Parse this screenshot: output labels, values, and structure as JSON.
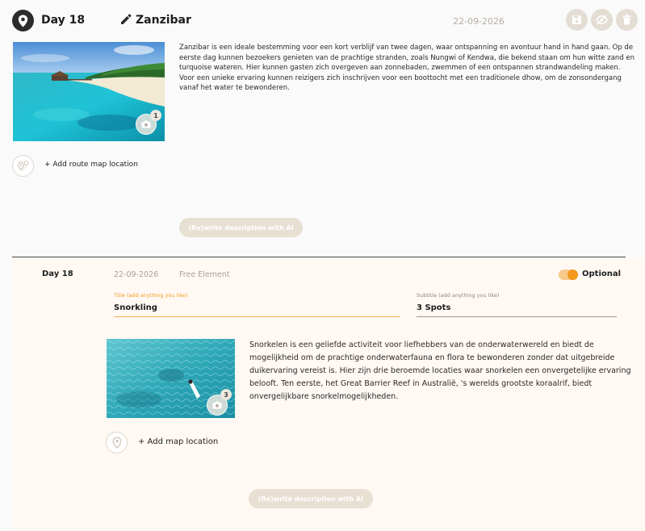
{
  "day_entry": {
    "day_label": "Day 18",
    "destination": "Zanzibar",
    "date": "22-09-2026",
    "actions": [
      {
        "icon": "save-icon"
      },
      {
        "icon": "eye-off-icon"
      },
      {
        "icon": "trash-icon"
      }
    ],
    "photo_count": "1",
    "description": "Zanzibar is een ideale bestemming voor een kort verblijf van twee dagen, waar ontspanning en avontuur hand in hand gaan. Op de eerste dag kunnen bezoekers genieten van de prachtige stranden, zoals Nungwi of Kendwa, die bekend staan om hun witte zand en turquoise wateren. Hier kunnen gasten zich overgeven aan zonnebaden, zwemmen of een ontspannen strandwandeling maken. Voor een unieke ervaring kunnen reizigers zich inschrijven voor een boottocht met een traditionele dhow, om de zonsondergang vanaf het water te bewonderen.",
    "add_route_label": "+ Add route map location",
    "ai_button_label": "(Re)write description with AI"
  },
  "free_element": {
    "day_label": "Day 18",
    "date": "22-09-2026",
    "element_type": "Free Element",
    "optional": {
      "label": "Optional",
      "on": true
    },
    "title_field": {
      "label": "Title (add anything you like)",
      "value": "Snorkling"
    },
    "subtitle_field": {
      "label": "Subtitle (add anything you like)",
      "value": "3 Spots"
    },
    "photo_count": "3",
    "description": "Snorkelen is een geliefde activiteit voor liefhebbers van de onderwaterwereld en biedt de mogelijkheid om de prachtige onderwaterfauna en flora te bewonderen zonder dat uitgebreide duikervaring vereist is. Hier zijn drie beroemde locaties waar snorkelen een onvergetelijke ervaring belooft. Ten eerste, het Great Barrier Reef in Australië, 's werelds grootste koraalrif, biedt onvergelijkbare snorkelmogelijkheden.",
    "add_map_label": "+ Add map location",
    "ai_button_label": "(Re)write description with AI"
  },
  "colors": {
    "accent_orange": "#f39a1e",
    "button_beige": "#e7e0d3",
    "panel_bg": "#fff8f3"
  }
}
